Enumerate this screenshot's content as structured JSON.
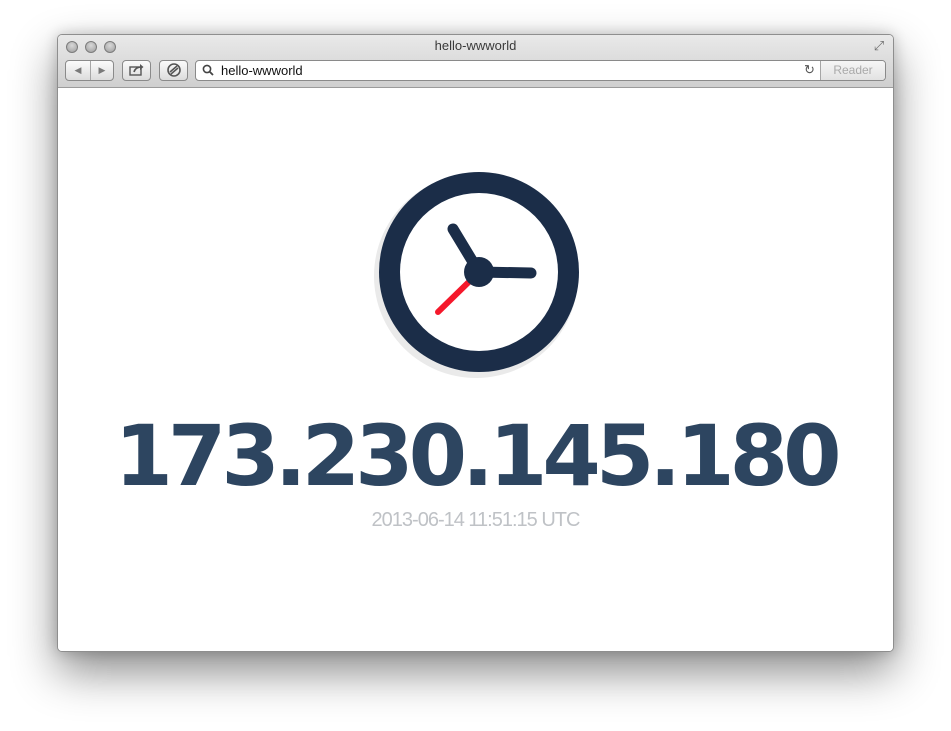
{
  "window": {
    "title": "hello-wwworld"
  },
  "toolbar": {
    "back_icon": "back-arrow-icon",
    "forward_icon": "forward-arrow-icon",
    "share_icon": "share-icon",
    "reading_list_icon": "reading-list-icon",
    "address_value": "hello-wwworld",
    "reader_label": "Reader"
  },
  "main": {
    "clock_icon": "clock-icon",
    "ip_address": "173.230.145.180",
    "timestamp": "2013-06-14 11:51:15 UTC"
  },
  "colors": {
    "clock_navy": "#1b2d48",
    "second_hand_red": "#f5182b",
    "ip_text": "#2d4560",
    "timestamp_text": "#bfc2c6"
  }
}
